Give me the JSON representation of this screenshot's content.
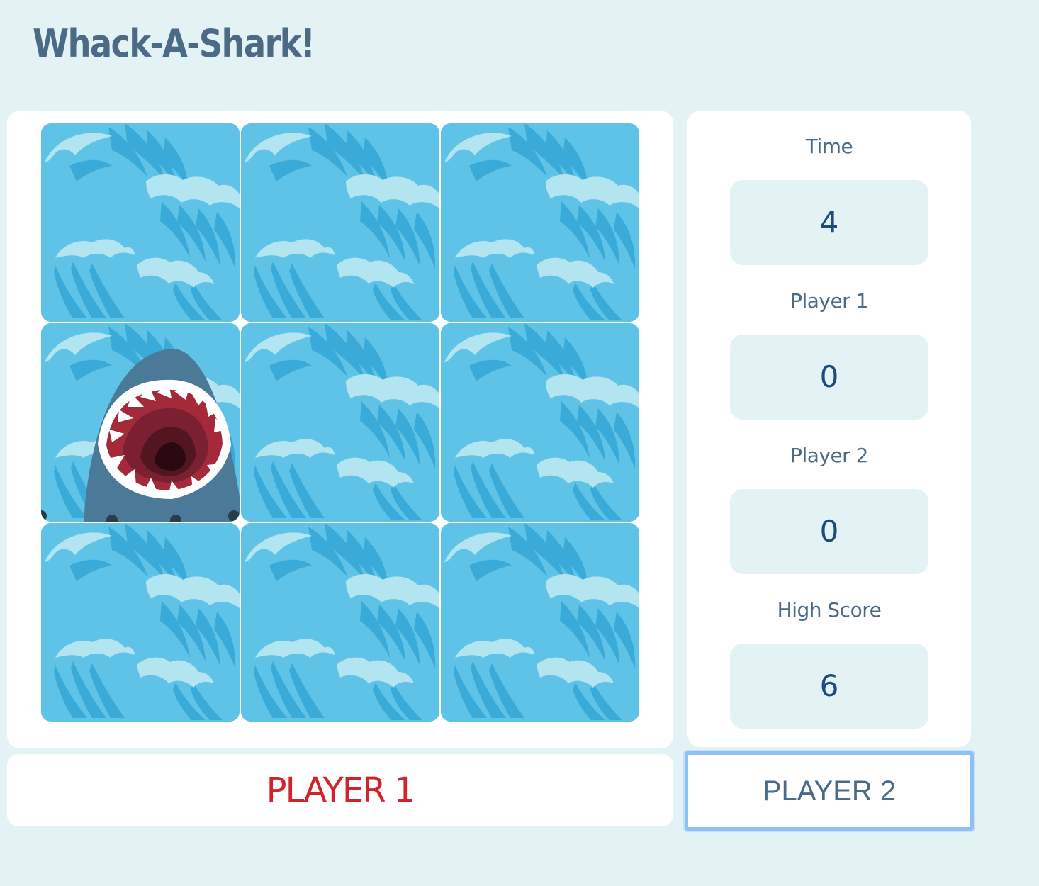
{
  "title": "Whack-A-Shark!",
  "board": {
    "rows": 3,
    "cols": 3,
    "holes": [
      {
        "content": "waves"
      },
      {
        "content": "waves"
      },
      {
        "content": "waves"
      },
      {
        "content": "shark"
      },
      {
        "content": "waves"
      },
      {
        "content": "waves"
      },
      {
        "content": "waves"
      },
      {
        "content": "waves"
      },
      {
        "content": "waves"
      }
    ],
    "colors": {
      "water": "#5ec3e6",
      "wave_dark": "#3aaad8",
      "wave_foam": "#b2e5f0",
      "shark": "#4b7a99",
      "mouth": "#a52a39"
    }
  },
  "stats": {
    "time_label": "Time",
    "time_value": "4",
    "p1_label": "Player 1",
    "p1_value": "0",
    "p2_label": "Player 2",
    "p2_value": "0",
    "high_label": "High Score",
    "high_value": "6"
  },
  "buttons": {
    "player1": "PLAYER 1",
    "player2": "PLAYER 2"
  },
  "colors": {
    "background": "#e3f2f4",
    "title": "#4b6a85",
    "player1_active": "#d0242c",
    "focus_ring": "#8fc0f2"
  }
}
